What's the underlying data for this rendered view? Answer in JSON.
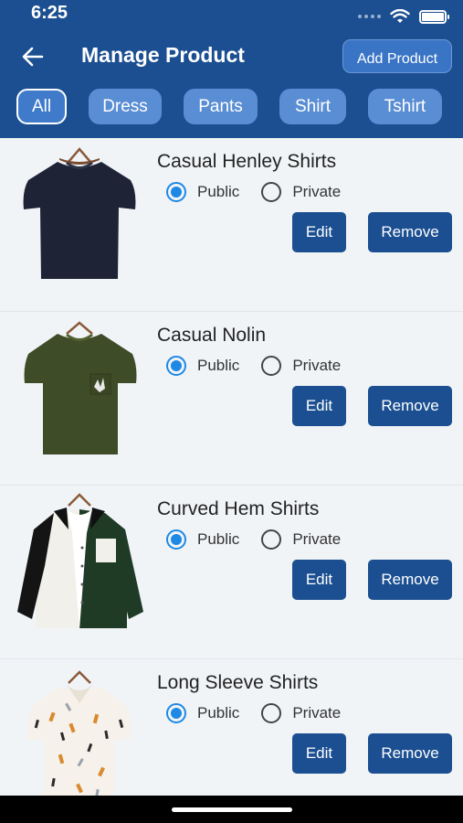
{
  "status": {
    "time": "6:25"
  },
  "header": {
    "title": "Manage Product",
    "add_label": "Add Product"
  },
  "filters": [
    {
      "label": "All",
      "active": true
    },
    {
      "label": "Dress",
      "active": false
    },
    {
      "label": "Pants",
      "active": false
    },
    {
      "label": "Shirt",
      "active": false
    },
    {
      "label": "Tshirt",
      "active": false
    }
  ],
  "visibility": {
    "public_label": "Public",
    "private_label": "Private"
  },
  "actions": {
    "edit_label": "Edit",
    "remove_label": "Remove"
  },
  "products": [
    {
      "name": "Casual Henley Shirts",
      "visibility": "Public",
      "image": "navy-tshirt"
    },
    {
      "name": "Casual Nolin",
      "visibility": "Public",
      "image": "olive-pocket-tshirt"
    },
    {
      "name": "Curved Hem Shirts",
      "visibility": "Public",
      "image": "colorblock-shirt"
    },
    {
      "name": "Long Sleeve Shirts",
      "visibility": "Public",
      "image": "print-shirt"
    }
  ],
  "colors": {
    "primary": "#1b4f91",
    "chip": "#5a8ed4",
    "radio": "#1e88e5",
    "background": "#f1f4f7"
  }
}
